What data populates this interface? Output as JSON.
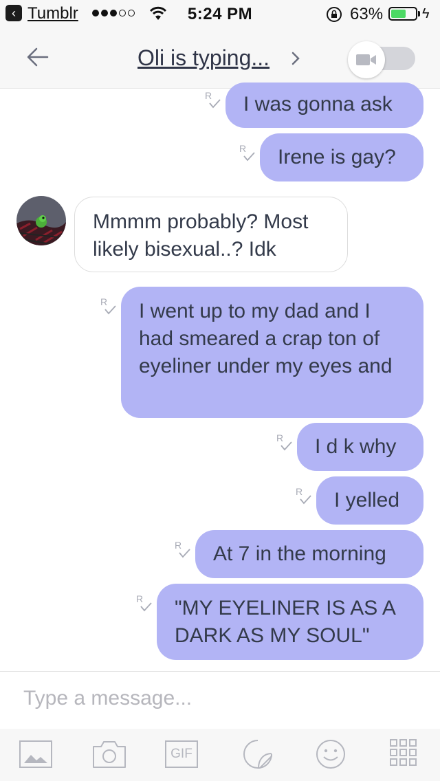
{
  "status_bar": {
    "back_app": "Tumblr",
    "time": "5:24 PM",
    "battery": "63%",
    "battery_level": 0.63,
    "signal_dots": [
      true,
      true,
      true,
      false,
      false
    ]
  },
  "header": {
    "title": "Oli is typing..."
  },
  "messages": [
    {
      "side": "out",
      "text": "I was gonna ask"
    },
    {
      "side": "out",
      "text": "Irene is gay?"
    },
    {
      "side": "in",
      "text": "Mmmm probably? Most likely bisexual..? Idk"
    },
    {
      "side": "out",
      "text": "I went up to my dad and I had smeared a crap ton of eyeliner under my eyes and"
    },
    {
      "side": "out",
      "text": "I d k why"
    },
    {
      "side": "out",
      "text": "I yelled"
    },
    {
      "side": "out",
      "text": "At 7 in the morning"
    },
    {
      "side": "out",
      "text": "\"MY EYELINER IS AS A DARK AS MY SOUL\""
    }
  ],
  "composer": {
    "placeholder": "Type a message..."
  },
  "toolbar": {
    "items": [
      "image-icon",
      "camera-icon",
      "gif-icon",
      "sticker-icon",
      "emoji-icon",
      "grid-icon"
    ],
    "gif_label": "GIF"
  },
  "colors": {
    "outgoing_bubble": "#b2b4f5",
    "incoming_bubble": "#ffffff",
    "text": "#333a4a"
  }
}
